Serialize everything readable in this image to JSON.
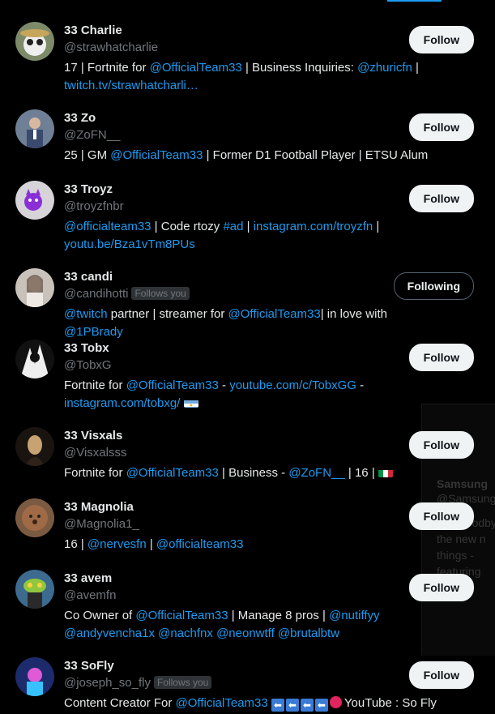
{
  "accounts": [
    {
      "name": "33 Charlie",
      "handle": "@strawhatcharlie",
      "follows_you": false,
      "button": "Follow",
      "bio": [
        {
          "t": "17 | Fortnite for "
        },
        {
          "t": "@OfficialTeam33",
          "l": true
        },
        {
          "t": " | Business Inquiries: "
        },
        {
          "t": "@zhuricfn",
          "l": true
        },
        {
          "t": " | "
        },
        {
          "t": "twitch.tv/strawhatcharli…",
          "l": true
        }
      ]
    },
    {
      "name": "33 Zo",
      "handle": "@ZoFN__",
      "follows_you": false,
      "button": "Follow",
      "bio": [
        {
          "t": "25 | GM "
        },
        {
          "t": "@OfficialTeam33",
          "l": true
        },
        {
          "t": " | Former D1 Football Player | ETSU Alum"
        }
      ]
    },
    {
      "name": "33 Troyz",
      "handle": "@troyzfnbr",
      "follows_you": false,
      "button": "Follow",
      "bio": [
        {
          "t": "@officialteam33",
          "l": true
        },
        {
          "t": " | Code rtozy "
        },
        {
          "t": "#ad",
          "l": true
        },
        {
          "t": " | "
        },
        {
          "t": "instagram.com/troyzfn",
          "l": true
        },
        {
          "t": " | "
        },
        {
          "t": "youtu.be/Bza1vTm8PUs",
          "l": true
        }
      ]
    },
    {
      "name": "33 candi",
      "handle": "@candihotti",
      "follows_you": true,
      "follows_you_label": "Follows you",
      "button": "Following",
      "bio": [
        {
          "t": "@twitch",
          "l": true
        },
        {
          "t": " partner | streamer for "
        },
        {
          "t": "@OfficialTeam33",
          "l": true
        },
        {
          "t": "| in love with "
        },
        {
          "t": "@1PBrady",
          "l": true
        }
      ]
    },
    {
      "name": "33 Tobx",
      "handle": "@TobxG",
      "follows_you": false,
      "button": "Follow",
      "bio": [
        {
          "t": "Fortnite for "
        },
        {
          "t": "@OfficialTeam33",
          "l": true
        },
        {
          "t": " - "
        },
        {
          "t": "youtube.com/c/TobxGG",
          "l": true
        },
        {
          "t": " - "
        },
        {
          "t": "instagram.com/tobxg/",
          "l": true
        },
        {
          "t": " "
        },
        {
          "flag": "ar"
        }
      ]
    },
    {
      "name": "33 Visxals",
      "handle": "@Visxalsss",
      "follows_you": false,
      "button": "Follow",
      "bio": [
        {
          "t": "Fortnite for "
        },
        {
          "t": "@OfficialTeam33",
          "l": true
        },
        {
          "t": " | Business - "
        },
        {
          "t": "@ZoFN__",
          "l": true
        },
        {
          "t": " | 16 | "
        },
        {
          "flag": "it"
        }
      ]
    },
    {
      "name": "33 Magnolia",
      "handle": "@Magnolia1_",
      "follows_you": false,
      "button": "Follow",
      "bio": [
        {
          "t": "16 | "
        },
        {
          "t": "@nervesfn",
          "l": true
        },
        {
          "t": " | "
        },
        {
          "t": "@officialteam33",
          "l": true
        }
      ]
    },
    {
      "name": "33 avem",
      "handle": "@avemfn",
      "follows_you": false,
      "button": "Follow",
      "bio": [
        {
          "t": "Co Owner of "
        },
        {
          "t": "@OfficialTeam33",
          "l": true
        },
        {
          "t": " | Manage 8 pros | "
        },
        {
          "t": "@nutiffyy",
          "l": true
        },
        {
          "t": " "
        },
        {
          "t": "@andyvencha1x",
          "l": true
        },
        {
          "t": " "
        },
        {
          "t": "@nachfnx",
          "l": true
        },
        {
          "t": " "
        },
        {
          "t": "@neonwtff",
          "l": true
        },
        {
          "t": " "
        },
        {
          "t": "@brutalbtw",
          "l": true
        }
      ]
    },
    {
      "name": "33 SoFly",
      "handle": "@joseph_so_fly",
      "follows_you": true,
      "follows_you_label": "Follows you",
      "button": "Follow",
      "bio": [
        {
          "t": "Content Creator For "
        },
        {
          "t": "@OfficialTeam33",
          "l": true
        },
        {
          "t": " "
        },
        {
          "arrows": "🡄🡄🡄🡄"
        },
        {
          "dot": true
        },
        {
          "t": "YouTube : So Fly"
        }
      ]
    }
  ],
  "ghost_popup": {
    "lines": [
      "Samsung",
      "@Samsung",
      "Say goodbye",
      "the new n",
      "things -",
      "featuring"
    ]
  },
  "colors": {
    "link": "#1d9bf0",
    "muted": "#71767b",
    "text": "#e7e9ea",
    "bg": "#000000"
  }
}
